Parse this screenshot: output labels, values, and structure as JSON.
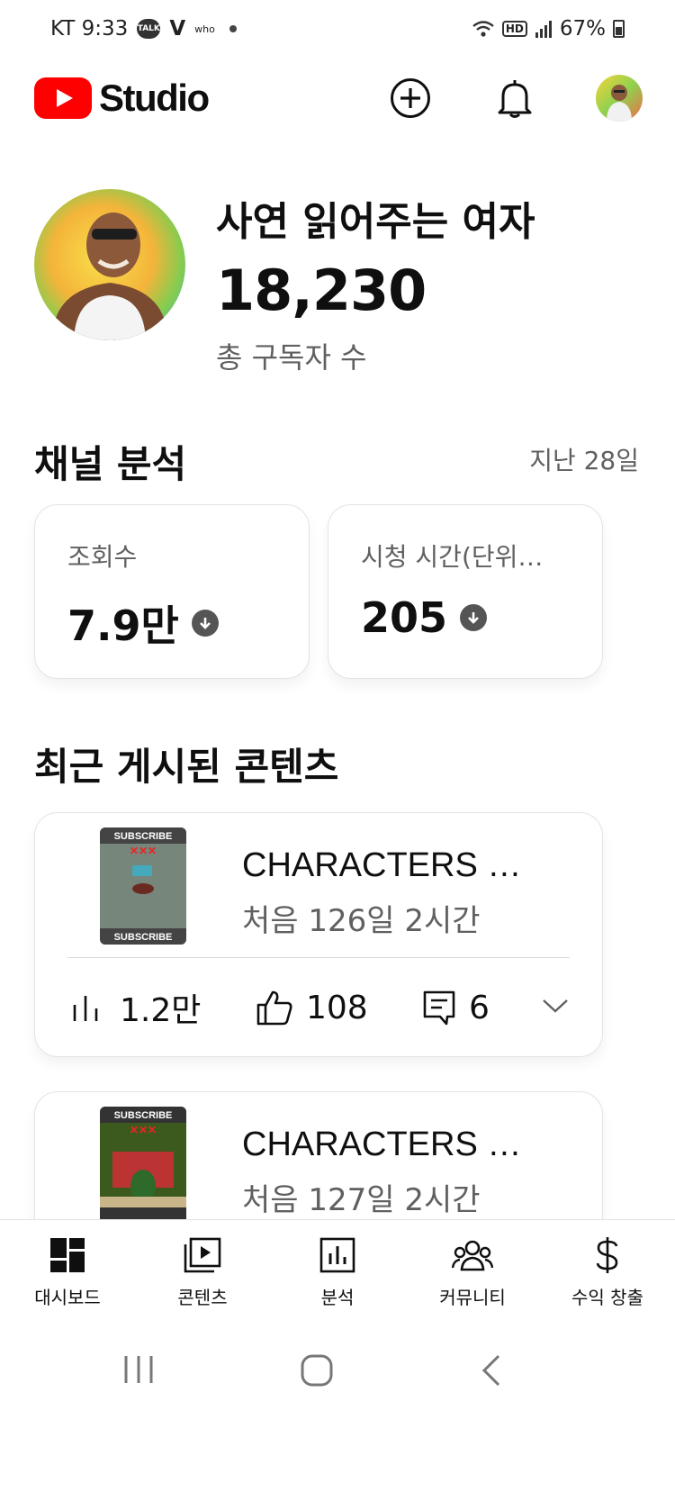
{
  "status_bar": {
    "carrier_time": "KT 9:33",
    "notification_badges": [
      "TALK",
      "V",
      "who"
    ],
    "network": "HD",
    "battery": "67%"
  },
  "app_bar": {
    "logo_text": "Studio",
    "icons": [
      "create-plus-icon",
      "notifications-bell-icon",
      "account-avatar"
    ]
  },
  "channel": {
    "name": "사연 읽어주는 여자",
    "subscriber_count": "18,230",
    "subscriber_label": "총 구독자 수"
  },
  "analytics": {
    "title": "채널 분석",
    "period": "지난 28일",
    "cards": [
      {
        "label": "조회수",
        "value": "7.9만",
        "trend": "down"
      },
      {
        "label": "시청 시간(단위…",
        "value": "205",
        "trend": "down"
      }
    ]
  },
  "recent": {
    "title": "최근 게시된 콘텐츠",
    "items": [
      {
        "title": "CHARACTERS 🤯 …",
        "age": "처음 126일 2시간",
        "views": "1.2만",
        "likes": "108",
        "comments": "6",
        "thumb_text": "SUBSCRIBE"
      },
      {
        "title": "CHARACTERS 🤯 …",
        "age": "처음 127일 2시간",
        "thumb_text": "SUBSCRIBE"
      }
    ]
  },
  "bottom_nav": [
    {
      "label": "대시보드",
      "icon": "dashboard-icon",
      "active": true
    },
    {
      "label": "콘텐츠",
      "icon": "content-icon"
    },
    {
      "label": "분석",
      "icon": "analytics-icon"
    },
    {
      "label": "커뮤니티",
      "icon": "community-icon"
    },
    {
      "label": "수익 창출",
      "icon": "dollar-icon"
    }
  ],
  "colors": {
    "brand_red": "#ff0000",
    "secondary_text": "#606060",
    "card_border": "#e3e3e3"
  }
}
